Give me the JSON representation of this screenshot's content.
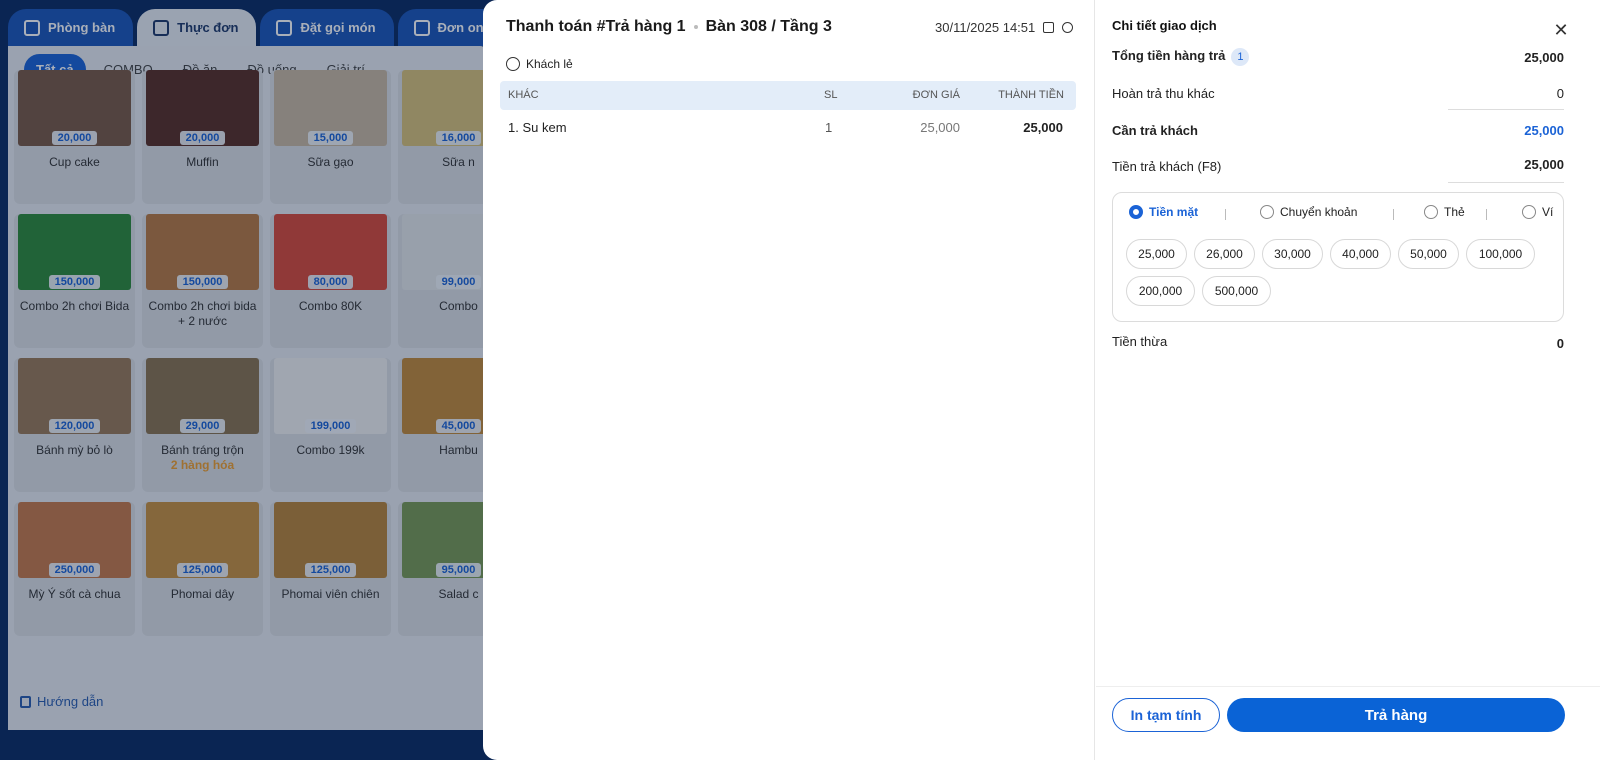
{
  "colors": {
    "accent": "#0a63d6",
    "note": "#f0a030",
    "header_bg": "#e3edf9"
  },
  "top_tabs": [
    {
      "label": "Phòng bàn",
      "icon": "table-icon"
    },
    {
      "label": "Thực đơn",
      "icon": "menu-icon"
    },
    {
      "label": "Đặt gọi món",
      "icon": "order-icon"
    },
    {
      "label": "Đơn online",
      "icon": "bag-icon"
    }
  ],
  "categories": [
    "Tất cả",
    "COMBO",
    "Đồ ăn",
    "Đồ uống",
    "Giải trí"
  ],
  "menu_items": [
    {
      "price": "20,000",
      "name": "Cup cake",
      "thumb": "#7a5a45"
    },
    {
      "price": "20,000",
      "name": "Muffin",
      "thumb": "#5a2f25"
    },
    {
      "price": "15,000",
      "name": "Sữa gạo",
      "thumb": "#c9b9a2"
    },
    {
      "price": "16,000",
      "name": "Sữa n",
      "thumb": "#d9c27a"
    },
    {
      "price": "150,000",
      "name": "Combo 2h chơi Bida",
      "thumb": "#2f8a3a"
    },
    {
      "price": "150,000",
      "name": "Combo 2h chơi bida + 2 nước",
      "thumb": "#b87a42"
    },
    {
      "price": "80,000",
      "name": "Combo 80K",
      "thumb": "#d94a3a"
    },
    {
      "price": "99,000",
      "name": "Combo",
      "thumb": "#e5e8ea"
    },
    {
      "price": "120,000",
      "name": "Bánh mỳ bỏ lò",
      "thumb": "#9a7a58"
    },
    {
      "price": "29,000",
      "name": "Bánh tráng trộn",
      "note": "2 hàng hóa",
      "thumb": "#8a7450"
    },
    {
      "price": "199,000",
      "name": "Combo 199k",
      "thumb": "#f2f2f2"
    },
    {
      "price": "45,000",
      "name": "Hambu",
      "thumb": "#c48a3a"
    },
    {
      "price": "250,000",
      "name": "Mỳ Ý sốt cà chua",
      "thumb": "#c77a4a"
    },
    {
      "price": "125,000",
      "name": "Phomai dây",
      "thumb": "#c8913f"
    },
    {
      "price": "125,000",
      "name": "Phomai viên chiên",
      "thumb": "#b8843a"
    },
    {
      "price": "95,000",
      "name": "Salad c",
      "thumb": "#7a9a55"
    }
  ],
  "guide_label": "Hướng dẫn",
  "order": {
    "title": "Thanh toán #Trả hàng 1",
    "location": "Bàn 308 / Tầng 3",
    "datetime": "30/11/2025 14:51",
    "customer": "Khách lẻ",
    "columns": {
      "name": "KHÁC",
      "qty": "SL",
      "unit_price": "ĐƠN GIÁ",
      "total": "THÀNH TIỀN"
    },
    "rows": [
      {
        "name": "1. Su kem",
        "qty": "1",
        "unit_price": "25,000",
        "total": "25,000"
      }
    ]
  },
  "details": {
    "title": "Chi tiết giao dịch",
    "total_return_label": "Tổng tiền hàng trả",
    "total_return_count": "1",
    "total_return_value": "25,000",
    "other_refund_label": "Hoàn trả thu khác",
    "other_refund_value": "0",
    "need_pay_label": "Cần trả khách",
    "need_pay_value": "25,000",
    "paid_label": "Tiền trả khách (F8)",
    "paid_value": "25,000",
    "methods": [
      "Tiền mặt",
      "Chuyển khoản",
      "Thẻ",
      "Ví"
    ],
    "active_method": "Tiền mặt",
    "quick_amounts": [
      "25,000",
      "26,000",
      "30,000",
      "40,000",
      "50,000",
      "100,000",
      "200,000",
      "500,000"
    ],
    "change_label": "Tiền thừa",
    "change_value": "0",
    "print_label": "In tạm tính",
    "submit_label": "Trả hàng"
  }
}
